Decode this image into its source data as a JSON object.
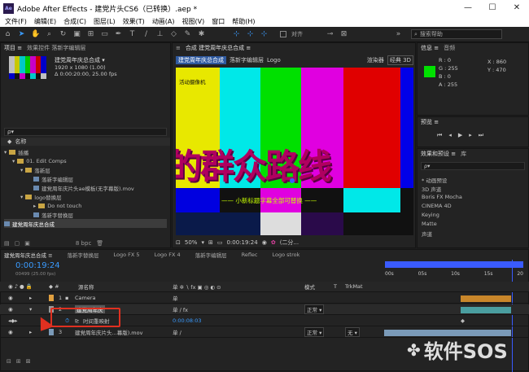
{
  "title": {
    "app": "Adobe After Effects - 建党片头CS6（已转换）.aep *"
  },
  "window_controls": {
    "minimize": "—",
    "maximize": "☐",
    "close": "✕"
  },
  "menu": [
    "文件(F)",
    "编辑(E)",
    "合成(C)",
    "图层(L)",
    "效果(T)",
    "动画(A)",
    "视图(V)",
    "窗口",
    "帮助(H)"
  ],
  "toolbar": {
    "snap_label": "对齐",
    "search_placeholder": "搜索帮助"
  },
  "project": {
    "tab": "项目 ≡",
    "tab2": "效果控件 落新字编辑层",
    "comp_name": "建党周年庆总合成 ▾",
    "resolution": "1920 x 1080 (1.00)",
    "duration": "Δ 0:00:20:00, 25.00 fps",
    "col_name": "名称",
    "items": [
      "插播",
      "01. Edit Comps",
      "落新层",
      "落新字编辑层",
      "建党周年庆片头ae模板(无字幕版).mov",
      "logo替换层",
      "Do not touch",
      "落新字替换层",
      "建党周年庆总合成"
    ],
    "bpc": "8 bpc"
  },
  "composition": {
    "tab": "合成 建党周年庆总合成 ≡",
    "sub_tab1": "建党周年庆总合成",
    "sub_tab2": "落新字编辑层",
    "sub_tab3": "Logo",
    "renderer": "渲染器",
    "classic3d": "经典 3D",
    "active_camera": "活动摄像机",
    "big_text": "的群众路线",
    "subtitle": "—— 小新标题字幕全部可替换 ——",
    "zoom": "50%",
    "timecode": "0:00:19:24",
    "res": "(二分..."
  },
  "info": {
    "tab": "信息 ≡",
    "tab2": "音频",
    "r": "R : 0",
    "g": "G : 255",
    "b": "B : 0",
    "a": "A : 255",
    "x": "X : 860",
    "y": "Y : 470",
    "swatch": "#00e000"
  },
  "preview": {
    "tab": "预览 ≡"
  },
  "effects": {
    "tab": "效果和预设 ≡",
    "tab2": "库",
    "search": "ρ▾",
    "items": [
      "* 动画预设",
      "3D 声道",
      "Boris FX Mocha",
      "CINEMA 4D",
      "Keying",
      "Matte",
      "声道"
    ]
  },
  "timeline": {
    "tabs": [
      "建党周年庆总合成 ≡",
      "落新字替换层",
      "Logo FX 5",
      "Logo FX 4",
      "落新字编辑层",
      "Reflec",
      "Logo strok"
    ],
    "timecode": "0:00:19:24",
    "frames": "00499 (25.00 fps)",
    "col_source": "源名称",
    "col_mode": "模式",
    "col_t": "T",
    "col_trkmat": "TrkMat",
    "ruler": [
      "00s",
      "05s",
      "10s",
      "15s",
      "20"
    ],
    "layers": [
      {
        "num": "1",
        "name": "Camera",
        "mode": "",
        "trk": ""
      },
      {
        "num": "2",
        "name": "建党周年庆",
        "mode": "正常 ▾",
        "trk": ""
      },
      {
        "num": "",
        "name": "时间重映射",
        "mode": "",
        "trk": "0:00:08:03"
      },
      {
        "num": "3",
        "name": "建党周年庆片头...幕版).mov",
        "mode": "正常 ▾",
        "trk": "无 ▾"
      }
    ]
  },
  "watermark": "软件SOS"
}
